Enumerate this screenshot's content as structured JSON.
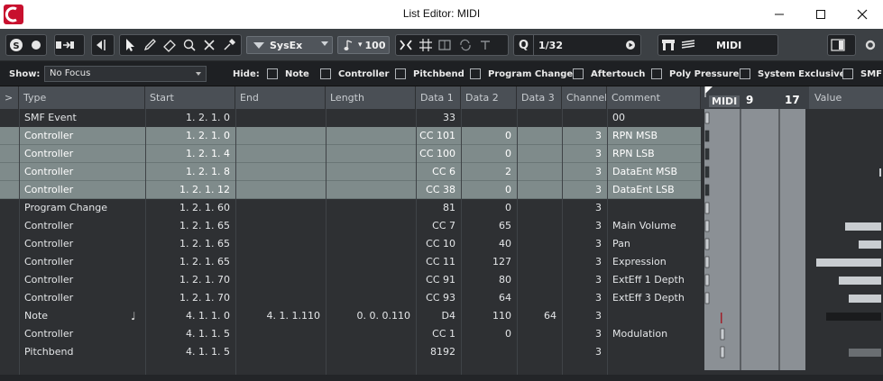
{
  "window": {
    "title": "List Editor: MIDI",
    "minimize_icon": "minimize-icon",
    "maximize_icon": "maximize-icon",
    "close_icon": "close-icon"
  },
  "toolbar": {
    "sysex_label": "SysEx",
    "velocity_value": "100",
    "quantize_label": "Q",
    "quantize_value": "1/32",
    "track_label": "MIDI"
  },
  "filterbar": {
    "show_label": "Show:",
    "focus_value": "No Focus",
    "hide_label": "Hide:",
    "filters": [
      "Note",
      "Controller",
      "Pitchbend",
      "Program Change",
      "Aftertouch",
      "Poly Pressure",
      "System Exclusive",
      "SMF"
    ]
  },
  "table": {
    "columns": [
      ">",
      "Type",
      "Start",
      "End",
      "Length",
      "Data 1",
      "Data 2",
      "Data 3",
      "Channel",
      "Comment"
    ],
    "rows": [
      {
        "type": "SMF Event",
        "start": "1.  2.  1.   0",
        "end": "",
        "length": "",
        "d1": "33",
        "d2": "",
        "d3": "",
        "ch": "",
        "comment": "00",
        "selected": false
      },
      {
        "type": "Controller",
        "start": "1.  2.  1.   0",
        "end": "",
        "length": "",
        "d1": "CC 101",
        "d2": "0",
        "d3": "",
        "ch": "3",
        "comment": "RPN MSB",
        "selected": true
      },
      {
        "type": "Controller",
        "start": "1.  2.  1.   4",
        "end": "",
        "length": "",
        "d1": "CC 100",
        "d2": "0",
        "d3": "",
        "ch": "3",
        "comment": "RPN LSB",
        "selected": true
      },
      {
        "type": "Controller",
        "start": "1.  2.  1.   8",
        "end": "",
        "length": "",
        "d1": "CC 6",
        "d2": "2",
        "d3": "",
        "ch": "3",
        "comment": "DataEnt MSB",
        "selected": true
      },
      {
        "type": "Controller",
        "start": "1.  2.  1.  12",
        "end": "",
        "length": "",
        "d1": "CC 38",
        "d2": "0",
        "d3": "",
        "ch": "3",
        "comment": "DataEnt LSB",
        "selected": true
      },
      {
        "type": "Program Change",
        "start": "1.  2.  1.  60",
        "end": "",
        "length": "",
        "d1": "81",
        "d2": "0",
        "d3": "",
        "ch": "3",
        "comment": "",
        "selected": false
      },
      {
        "type": "Controller",
        "start": "1.  2.  1.  65",
        "end": "",
        "length": "",
        "d1": "CC 7",
        "d2": "65",
        "d3": "",
        "ch": "3",
        "comment": "Main Volume",
        "selected": false
      },
      {
        "type": "Controller",
        "start": "1.  2.  1.  65",
        "end": "",
        "length": "",
        "d1": "CC 10",
        "d2": "40",
        "d3": "",
        "ch": "3",
        "comment": "Pan",
        "selected": false
      },
      {
        "type": "Controller",
        "start": "1.  2.  1.  65",
        "end": "",
        "length": "",
        "d1": "CC 11",
        "d2": "127",
        "d3": "",
        "ch": "3",
        "comment": "Expression",
        "selected": false
      },
      {
        "type": "Controller",
        "start": "1.  2.  1.  70",
        "end": "",
        "length": "",
        "d1": "CC 91",
        "d2": "80",
        "d3": "",
        "ch": "3",
        "comment": "ExtEff 1 Depth",
        "selected": false
      },
      {
        "type": "Controller",
        "start": "1.  2.  1.  70",
        "end": "",
        "length": "",
        "d1": "CC 93",
        "d2": "64",
        "d3": "",
        "ch": "3",
        "comment": "ExtEff 3 Depth",
        "selected": false
      },
      {
        "type": "Note",
        "start": "4.  1.  1.   0",
        "end": "4.  1.  1.110",
        "length": "0.  0.  0.110",
        "d1": "D4",
        "d2": "110",
        "d3": "64",
        "ch": "3",
        "comment": "",
        "selected": false
      },
      {
        "type": "Controller",
        "start": "4.  1.  1.   5",
        "end": "",
        "length": "",
        "d1": "CC 1",
        "d2": "0",
        "d3": "",
        "ch": "3",
        "comment": "Modulation",
        "selected": false
      },
      {
        "type": "Pitchbend",
        "start": "4.  1.  1.   5",
        "end": "",
        "length": "",
        "d1": "8192",
        "d2": "",
        "d3": "",
        "ch": "3",
        "comment": "",
        "selected": false
      }
    ]
  },
  "pianoroll": {
    "track_tag": "MIDI",
    "bars": [
      "9",
      "17"
    ]
  },
  "values": {
    "header": "Value",
    "levels": [
      0,
      0,
      0,
      0.03,
      0,
      0,
      0.55,
      0.35,
      1.0,
      0.65,
      0.5,
      0.85,
      0,
      0.5
    ]
  }
}
